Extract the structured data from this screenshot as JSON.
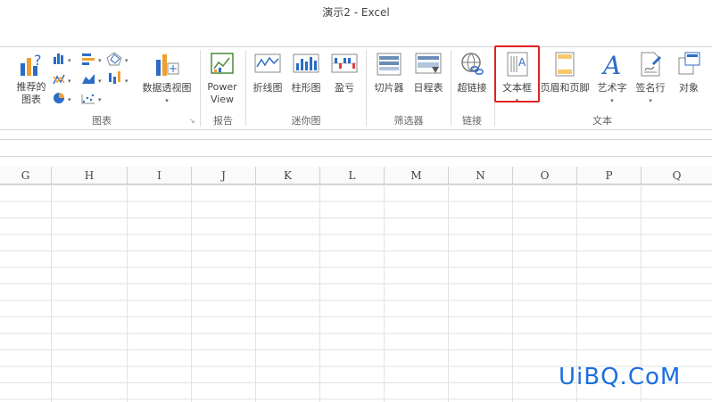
{
  "window": {
    "title": "演示2 - Excel"
  },
  "ribbon": {
    "groups": {
      "charts": {
        "label": "图表",
        "recommended_label": "推荐的\n图表",
        "pivot_chart_label": "数据透视图"
      },
      "reports": {
        "label": "报告",
        "power_view_label": "Power\nView"
      },
      "sparklines": {
        "label": "迷你图",
        "line_label": "折线图",
        "column_label": "柱形图",
        "winloss_label": "盈亏"
      },
      "filters": {
        "label": "筛选器",
        "slicer_label": "切片器",
        "timeline_label": "日程表"
      },
      "links": {
        "label": "链接",
        "hyperlink_label": "超链接"
      },
      "text": {
        "label": "文本",
        "textbox_label": "文本框",
        "header_footer_label": "页眉和页脚",
        "wordart_label": "艺术字",
        "signature_label": "签名行",
        "object_label": "对象"
      }
    }
  },
  "sheet": {
    "columns": [
      "G",
      "H",
      "I",
      "J",
      "K",
      "L",
      "M",
      "N",
      "O",
      "P",
      "Q"
    ]
  },
  "watermark": {
    "text": "UiBQ.CoM"
  },
  "colors": {
    "accent_blue": "#2b6cc4",
    "highlight_red": "#e02020",
    "watermark_blue": "#1c6fe0"
  }
}
